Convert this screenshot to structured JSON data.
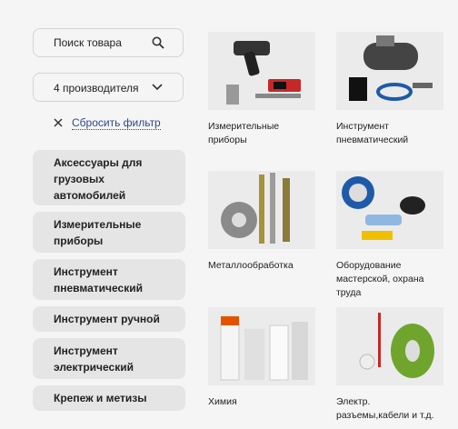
{
  "search": {
    "placeholder": "Поиск товара"
  },
  "filter": {
    "manufacturers_label": "4 производителя",
    "reset_label": "Сбросить фильтр"
  },
  "categories": [
    {
      "label": "Аксессуары для грузовых автомобилей"
    },
    {
      "label": "Измерительные приборы"
    },
    {
      "label": "Инструмент пневматический"
    },
    {
      "label": "Инструмент ручной"
    },
    {
      "label": "Инструмент электрический"
    },
    {
      "label": "Крепеж и метизы"
    }
  ],
  "tiles": [
    {
      "caption": "Измерительные приборы",
      "icon": "measuring-tools-image"
    },
    {
      "caption": "Инструмент пневматический",
      "icon": "compressor-image"
    },
    {
      "caption": "Металлообработка",
      "icon": "metalworking-image"
    },
    {
      "caption": "Оборудование мастерской, охрана труда",
      "icon": "workshop-equipment-image"
    },
    {
      "caption": "Химия",
      "icon": "chemicals-image"
    },
    {
      "caption": "Электр. разъемы,кабели и т.д.",
      "icon": "cables-image"
    }
  ],
  "colors": {
    "link": "#2b4a8c",
    "pill": "#e5e5e5",
    "border": "#d4d4d4",
    "background": "#f5f5f5"
  }
}
